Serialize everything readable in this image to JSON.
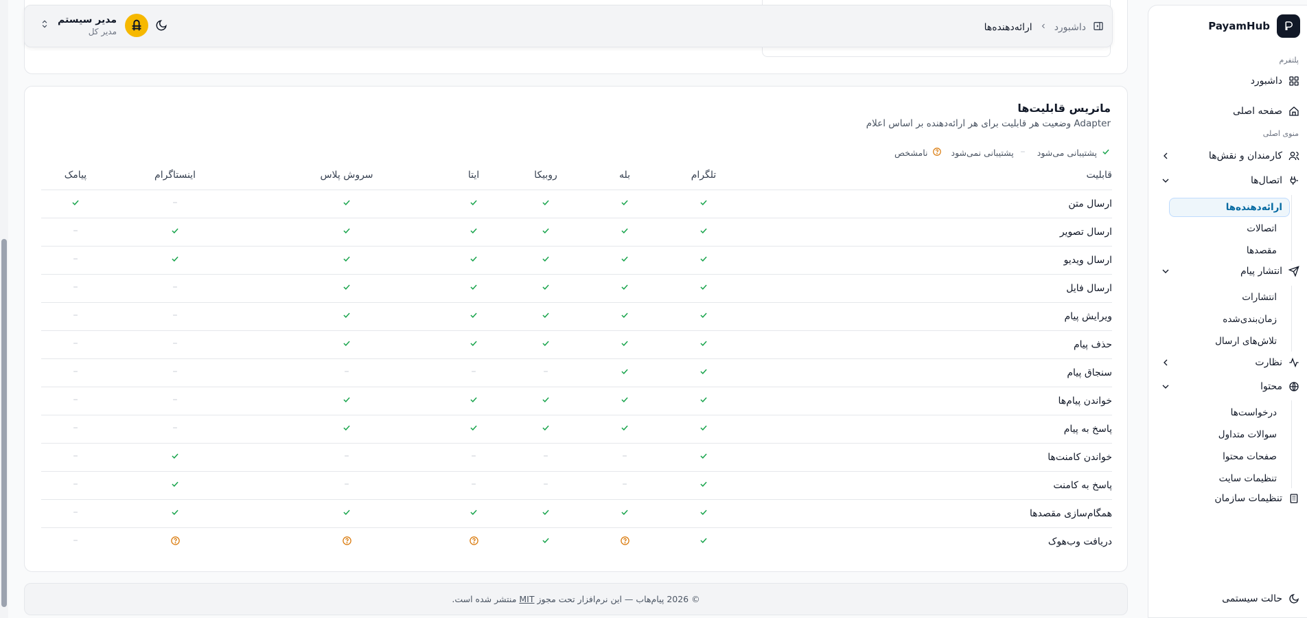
{
  "sidebar": {
    "brand": "PayamHub",
    "groups": {
      "platform": "پلتفرم",
      "main_menu": "منوی اصلی"
    },
    "items": {
      "dashboard": "داشبورد",
      "home": "صفحه اصلی",
      "staff": "کارمندان و نقش‌ها",
      "connections": "اتصال‌ها",
      "publish": "انتشار پیام",
      "monitoring": "نظارت",
      "content": "محتوا",
      "org_settings": "تنظیمات سازمان",
      "system_mode": "حالت سیستمی"
    },
    "connections_sub": [
      "ارائه‌دهنده‌ها",
      "اتصالات",
      "مقصدها"
    ],
    "publish_sub": [
      "انتشارات",
      "زمان‌بندی‌شده",
      "تلاش‌های ارسال"
    ],
    "content_sub": [
      "درخواست‌ها",
      "سوالات متداول",
      "صفحات محتوا",
      "تنظیمات سایت"
    ]
  },
  "header": {
    "breadcrumb": {
      "root": "داشبورد",
      "current": "ارائه‌دهنده‌ها"
    },
    "user": {
      "name": "مدیر سیستم",
      "role": "مدیر کل"
    }
  },
  "matrix": {
    "title": "ماتریس قابلیت‌ها",
    "description": "وضعیت هر قابلیت برای هر ارائه‌دهنده بر اساس اعلام Adapter",
    "legend": {
      "supported": "پشتیبانی می‌شود",
      "unsupported": "پشتیبانی نمی‌شود",
      "unknown": "نامشخص"
    },
    "capability_header": "قابلیت",
    "providers": [
      "تلگرام",
      "بله",
      "روبیکا",
      "ایتا",
      "سروش پلاس",
      "اینستاگرام",
      "پیامک"
    ],
    "rows": [
      {
        "cap": "ارسال متن",
        "v": [
          "y",
          "y",
          "y",
          "y",
          "y",
          "n",
          "y"
        ]
      },
      {
        "cap": "ارسال تصویر",
        "v": [
          "y",
          "y",
          "y",
          "y",
          "y",
          "y",
          "n"
        ]
      },
      {
        "cap": "ارسال ویدیو",
        "v": [
          "y",
          "y",
          "y",
          "y",
          "y",
          "y",
          "n"
        ]
      },
      {
        "cap": "ارسال فایل",
        "v": [
          "y",
          "y",
          "y",
          "y",
          "y",
          "n",
          "n"
        ]
      },
      {
        "cap": "ویرایش پیام",
        "v": [
          "y",
          "y",
          "y",
          "y",
          "y",
          "n",
          "n"
        ]
      },
      {
        "cap": "حذف پیام",
        "v": [
          "y",
          "y",
          "y",
          "y",
          "y",
          "n",
          "n"
        ]
      },
      {
        "cap": "سنجاق پیام",
        "v": [
          "y",
          "y",
          "n",
          "n",
          "n",
          "n",
          "n"
        ]
      },
      {
        "cap": "خواندن پیام‌ها",
        "v": [
          "y",
          "y",
          "y",
          "y",
          "y",
          "n",
          "n"
        ]
      },
      {
        "cap": "پاسخ به پیام",
        "v": [
          "y",
          "y",
          "y",
          "y",
          "y",
          "n",
          "n"
        ]
      },
      {
        "cap": "خواندن کامنت‌ها",
        "v": [
          "y",
          "n",
          "n",
          "n",
          "n",
          "y",
          "n"
        ]
      },
      {
        "cap": "پاسخ به کامنت",
        "v": [
          "y",
          "n",
          "n",
          "n",
          "n",
          "y",
          "n"
        ]
      },
      {
        "cap": "همگام‌سازی مقصدها",
        "v": [
          "y",
          "y",
          "y",
          "y",
          "y",
          "y",
          "n"
        ]
      },
      {
        "cap": "دریافت وب‌هوک",
        "v": [
          "y",
          "u",
          "y",
          "u",
          "u",
          "u",
          "n"
        ]
      }
    ]
  },
  "footer": {
    "prefix": "© 2026 پیام‌هاب — این نرم‌افزار تحت مجوز",
    "license": "MIT",
    "suffix": "منتشر شده است."
  },
  "colors": {
    "supported": "#16a34a",
    "unsupported": "#d1d5db",
    "unknown": "#d97706",
    "active_bg": "#eef6fb",
    "active_text": "#0369a1"
  }
}
